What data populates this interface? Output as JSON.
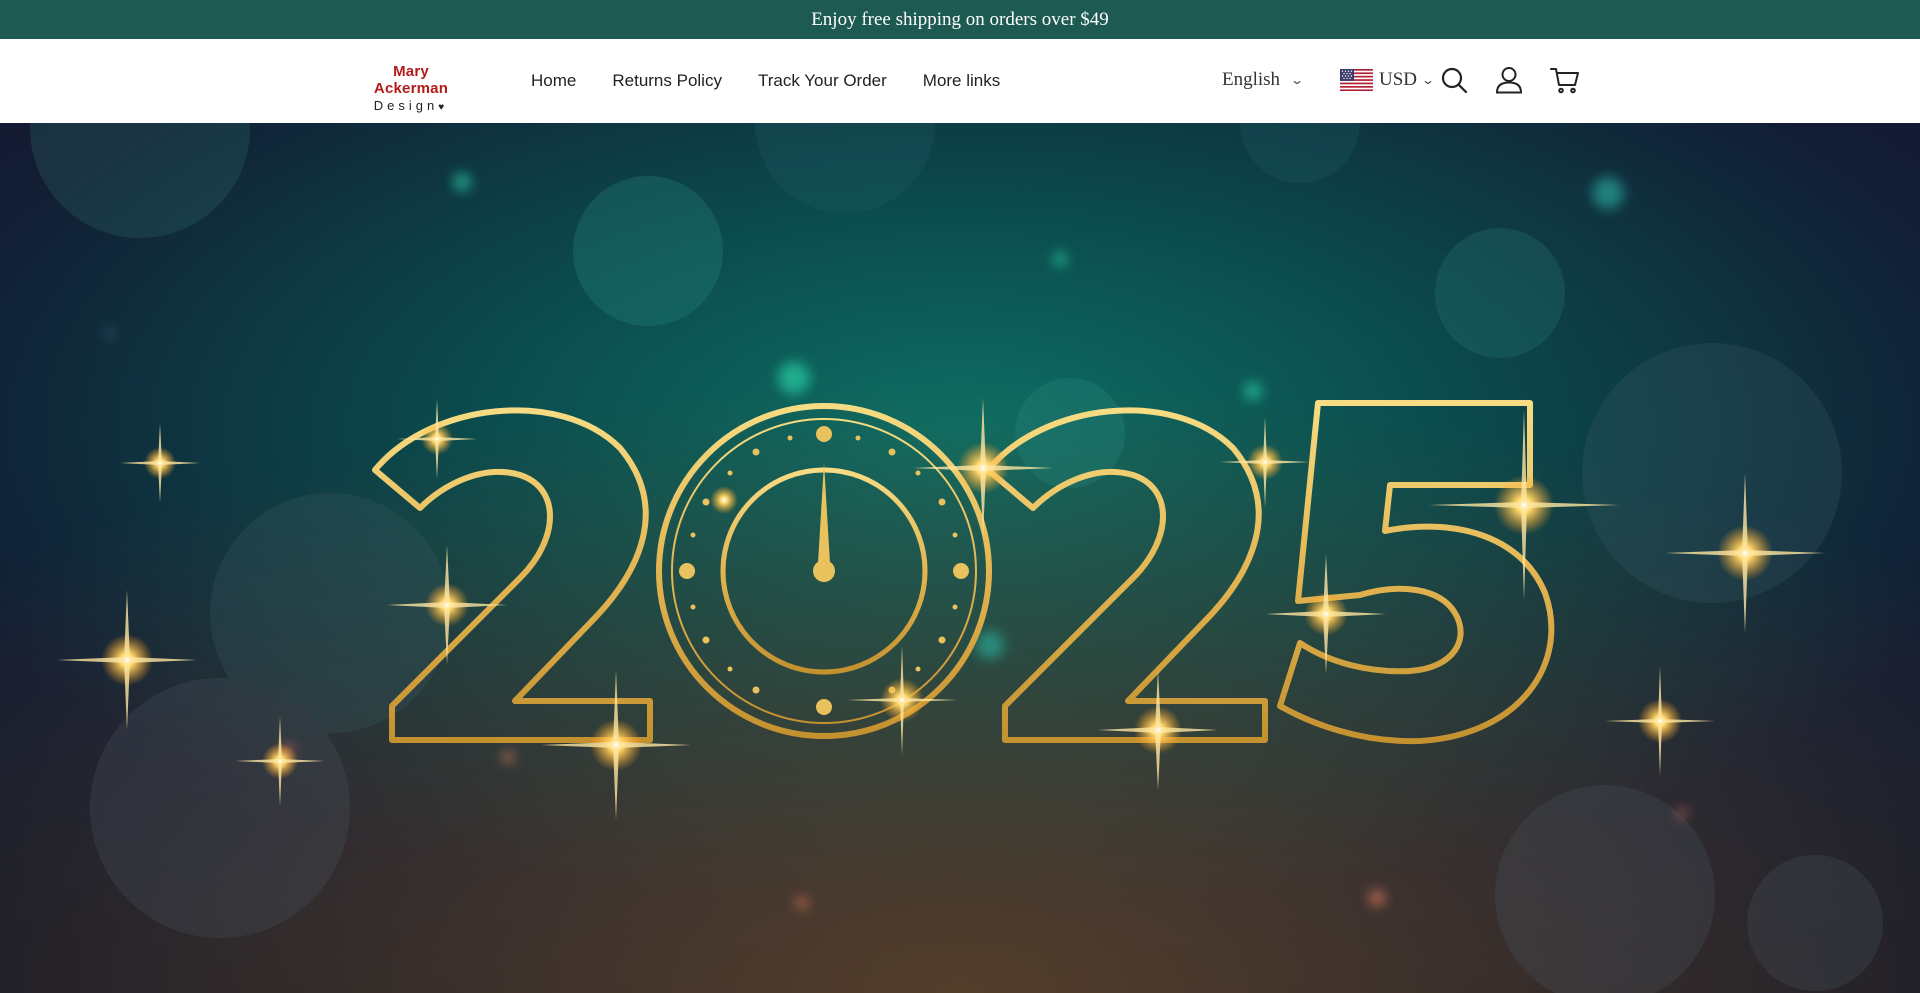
{
  "announcement": {
    "text": "Enjoy free shipping on orders over $49"
  },
  "header": {
    "logo": {
      "line1": "Mary Ackerman",
      "line2": "Design",
      "heart": "♥"
    },
    "nav": [
      {
        "label": "Home"
      },
      {
        "label": "Returns Policy"
      },
      {
        "label": "Track Your Order"
      },
      {
        "label": "More links"
      }
    ],
    "language": {
      "selected": "English",
      "icon": "chevron-down-icon"
    },
    "currency": {
      "selected": "USD",
      "flag": "us-flag-icon",
      "icon": "chevron-down-icon"
    },
    "icons": [
      "search-icon",
      "account-icon",
      "cart-icon"
    ]
  },
  "hero": {
    "digits": [
      "2",
      "0",
      "2",
      "5"
    ],
    "colors": {
      "gold": "#e9c25e",
      "teal": "#0e6e63",
      "navy": "#111a2e"
    }
  }
}
